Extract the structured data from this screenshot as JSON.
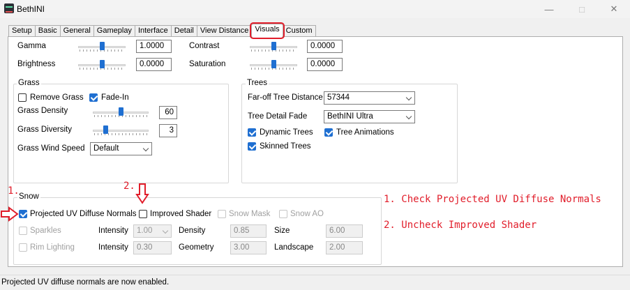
{
  "window": {
    "title": "BethINI"
  },
  "tabs": [
    "Setup",
    "Basic",
    "General",
    "Gameplay",
    "Interface",
    "Detail",
    "View Distance",
    "Visuals",
    "Custom"
  ],
  "active_tab": "Visuals",
  "top": {
    "gamma": {
      "label": "Gamma",
      "value": "1.0000",
      "slider_fraction": 0.5
    },
    "brightness": {
      "label": "Brightness",
      "value": "0.0000",
      "slider_fraction": 0.5
    },
    "contrast": {
      "label": "Contrast",
      "value": "0.0000",
      "slider_fraction": 0.5
    },
    "saturation": {
      "label": "Saturation",
      "value": "0.0000",
      "slider_fraction": 0.5
    }
  },
  "grass": {
    "title": "Grass",
    "remove_grass": {
      "label": "Remove Grass",
      "checked": false
    },
    "fade_in": {
      "label": "Fade-In",
      "checked": true
    },
    "density": {
      "label": "Grass Density",
      "value": "60",
      "slider_fraction": 0.5
    },
    "diversity": {
      "label": "Grass Diversity",
      "value": "3",
      "slider_fraction": 0.2
    },
    "wind": {
      "label": "Grass Wind Speed",
      "value": "Default"
    }
  },
  "trees": {
    "title": "Trees",
    "far_off": {
      "label": "Far-off Tree Distance",
      "value": "57344"
    },
    "detail_fade": {
      "label": "Tree Detail Fade",
      "value": "BethINI Ultra"
    },
    "dynamic": {
      "label": "Dynamic Trees",
      "checked": true
    },
    "animations": {
      "label": "Tree Animations",
      "checked": true
    },
    "skinned": {
      "label": "Skinned Trees",
      "checked": true
    }
  },
  "snow": {
    "title": "Snow",
    "projected_uv": {
      "label": "Projected UV Diffuse Normals",
      "checked": true
    },
    "improved_shader": {
      "label": "Improved Shader",
      "checked": false
    },
    "snow_mask": {
      "label": "Snow Mask",
      "checked": false
    },
    "snow_ao": {
      "label": "Snow AO",
      "checked": false
    },
    "sparkles": {
      "label": "Sparkles",
      "checked": false
    },
    "rim_lighting": {
      "label": "Rim Lighting",
      "checked": false
    },
    "intensity1_label": "Intensity",
    "intensity1_value": "1.00",
    "intensity2_label": "Intensity",
    "intensity2_value": "0.30",
    "density_label": "Density",
    "density_value": "0.85",
    "geometry_label": "Geometry",
    "geometry_value": "3.00",
    "size_label": "Size",
    "size_value": "6.00",
    "landscape_label": "Landscape",
    "landscape_value": "2.00"
  },
  "annotations": {
    "marker1": "1.",
    "marker2": "2.",
    "step1": "1. Check Projected UV Diffuse Normals",
    "step2": "2. Uncheck Improved Shader",
    "color": "#e11d2a"
  },
  "status": "Projected UV diffuse normals are now enabled."
}
